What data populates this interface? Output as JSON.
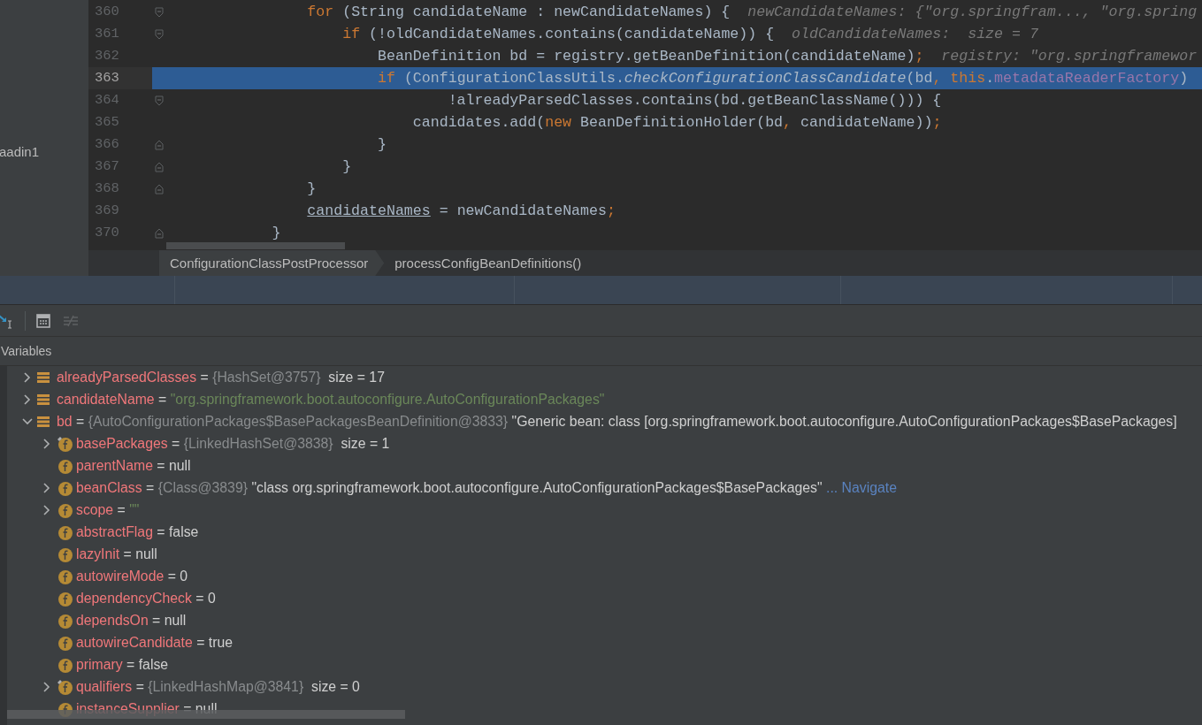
{
  "sidebar": {
    "items": [
      "aadin1"
    ]
  },
  "editor": {
    "lines": [
      {
        "number": "360",
        "current": false,
        "kind": "opening",
        "segments": [
          {
            "kind": "keyword",
            "text": "                for"
          },
          {
            "kind": "plain",
            "text": " (String candidateName : newCandidateNames) {"
          },
          {
            "kind": "hint",
            "text": "  newCandidateNames: {\"org.springfram..., \"org.spring"
          }
        ]
      },
      {
        "number": "361",
        "current": false,
        "kind": "opening",
        "segments": [
          {
            "kind": "keyword",
            "text": "                    if"
          },
          {
            "kind": "plain",
            "text": " (!oldCandidateNames.contains(candidateName)) {"
          },
          {
            "kind": "hint",
            "text": "  oldCandidateNames:  size = 7"
          }
        ]
      },
      {
        "number": "362",
        "current": false,
        "kind": "plain",
        "segments": [
          {
            "kind": "plain",
            "text": "                        BeanDefinition bd = registry.getBeanDefinition(candidateName)"
          },
          {
            "kind": "punct",
            "text": ";"
          },
          {
            "kind": "hint",
            "text": "  registry: \"org.springframewor"
          }
        ]
      },
      {
        "number": "363",
        "current": true,
        "kind": "plain",
        "segments": [
          {
            "kind": "keyword",
            "text": "                        if"
          },
          {
            "kind": "plain",
            "text": " (ConfigurationClassUtils."
          },
          {
            "kind": "call",
            "text": "checkConfigurationClassCandidate"
          },
          {
            "kind": "plain",
            "text": "(bd"
          },
          {
            "kind": "punct",
            "text": ", "
          },
          {
            "kind": "keyword",
            "text": "this"
          },
          {
            "kind": "plain",
            "text": "."
          },
          {
            "kind": "field",
            "text": "metadataReaderFactory"
          },
          {
            "kind": "plain",
            "text": ")"
          }
        ]
      },
      {
        "number": "364",
        "current": false,
        "kind": "opening",
        "segments": [
          {
            "kind": "plain",
            "text": "                                !alreadyParsedClasses.contains(bd.getBeanClassName())) {"
          }
        ]
      },
      {
        "number": "365",
        "current": false,
        "kind": "plain",
        "segments": [
          {
            "kind": "plain",
            "text": "                            candidates.add("
          },
          {
            "kind": "keyword",
            "text": "new"
          },
          {
            "kind": "plain",
            "text": " BeanDefinitionHolder(bd"
          },
          {
            "kind": "punct",
            "text": ", "
          },
          {
            "kind": "plain",
            "text": "candidateName))"
          },
          {
            "kind": "punct",
            "text": ";"
          }
        ]
      },
      {
        "number": "366",
        "current": false,
        "kind": "closing",
        "segments": [
          {
            "kind": "plain",
            "text": "                        }"
          }
        ]
      },
      {
        "number": "367",
        "current": false,
        "kind": "closing",
        "segments": [
          {
            "kind": "plain",
            "text": "                    }"
          }
        ]
      },
      {
        "number": "368",
        "current": false,
        "kind": "closing",
        "segments": [
          {
            "kind": "plain",
            "text": "                }"
          }
        ]
      },
      {
        "number": "369",
        "current": false,
        "kind": "plain",
        "segments": [
          {
            "kind": "link",
            "text": "                candidateNames"
          },
          {
            "kind": "plain",
            "text": " = newCandidateNames"
          },
          {
            "kind": "punct",
            "text": ";"
          }
        ]
      },
      {
        "number": "370",
        "current": false,
        "kind": "closing",
        "segments": [
          {
            "kind": "plain",
            "text": "            }"
          }
        ]
      }
    ]
  },
  "breadcrumbs": [
    {
      "text": "ConfigurationClassPostProcessor",
      "selected": true
    },
    {
      "text": "processConfigBeanDefinitions()",
      "selected": false
    }
  ],
  "variables_panel": {
    "title": "Variables",
    "variables": [
      {
        "kind": "variable",
        "name": "alreadyParsedClasses",
        "expandable": true,
        "expanded": false,
        "marked": false,
        "value": [
          {
            "kind": "plain",
            "text": "="
          },
          {
            "kind": "type",
            "text": "{HashSet@3757}"
          },
          {
            "kind": "plain",
            "text": " size = 17"
          }
        ]
      },
      {
        "kind": "variable",
        "name": "candidateName",
        "expandable": true,
        "expanded": false,
        "marked": false,
        "value": [
          {
            "kind": "plain",
            "text": "="
          },
          {
            "kind": "string",
            "text": "\"org.springframework.boot.autoconfigure.AutoConfigurationPackages\""
          }
        ]
      },
      {
        "kind": "variable",
        "name": "bd",
        "expandable": true,
        "expanded": true,
        "marked": false,
        "value": [
          {
            "kind": "plain",
            "text": "="
          },
          {
            "kind": "type",
            "text": "{AutoConfigurationPackages$BasePackagesBeanDefinition@3833}"
          },
          {
            "kind": "plain",
            "text": "\"Generic bean: class [org.springframework.boot.autoconfigure.AutoConfigurationPackages$BasePackages]"
          }
        ],
        "children": [
          {
            "kind": "field",
            "name": "basePackages",
            "expandable": true,
            "expanded": false,
            "marked": true,
            "value": [
              {
                "kind": "plain",
                "text": "="
              },
              {
                "kind": "type",
                "text": "{LinkedHashSet@3838}"
              },
              {
                "kind": "plain",
                "text": " size = 1"
              }
            ]
          },
          {
            "kind": "field",
            "name": "parentName",
            "expandable": false,
            "expanded": false,
            "marked": false,
            "value": [
              {
                "kind": "plain",
                "text": "= null"
              }
            ]
          },
          {
            "kind": "field",
            "name": "beanClass",
            "expandable": true,
            "expanded": false,
            "marked": false,
            "value": [
              {
                "kind": "plain",
                "text": "="
              },
              {
                "kind": "type",
                "text": "{Class@3839}"
              },
              {
                "kind": "plain",
                "text": "\"class org.springframework.boot.autoconfigure.AutoConfigurationPackages$BasePackages\""
              },
              {
                "kind": "link",
                "text": "... Navigate"
              }
            ]
          },
          {
            "kind": "field",
            "name": "scope",
            "expandable": true,
            "expanded": false,
            "marked": false,
            "value": [
              {
                "kind": "plain",
                "text": "="
              },
              {
                "kind": "string",
                "text": "\"\""
              }
            ]
          },
          {
            "kind": "field",
            "name": "abstractFlag",
            "expandable": false,
            "expanded": false,
            "marked": false,
            "value": [
              {
                "kind": "plain",
                "text": "= false"
              }
            ]
          },
          {
            "kind": "field",
            "name": "lazyInit",
            "expandable": false,
            "expanded": false,
            "marked": false,
            "value": [
              {
                "kind": "plain",
                "text": "= null"
              }
            ]
          },
          {
            "kind": "field",
            "name": "autowireMode",
            "expandable": false,
            "expanded": false,
            "marked": false,
            "value": [
              {
                "kind": "plain",
                "text": "= 0"
              }
            ]
          },
          {
            "kind": "field",
            "name": "dependencyCheck",
            "expandable": false,
            "expanded": false,
            "marked": false,
            "value": [
              {
                "kind": "plain",
                "text": "= 0"
              }
            ]
          },
          {
            "kind": "field",
            "name": "dependsOn",
            "expandable": false,
            "expanded": false,
            "marked": false,
            "value": [
              {
                "kind": "plain",
                "text": "= null"
              }
            ]
          },
          {
            "kind": "field",
            "name": "autowireCandidate",
            "expandable": false,
            "expanded": false,
            "marked": false,
            "value": [
              {
                "kind": "plain",
                "text": "= true"
              }
            ]
          },
          {
            "kind": "field",
            "name": "primary",
            "expandable": false,
            "expanded": false,
            "marked": false,
            "value": [
              {
                "kind": "plain",
                "text": "= false"
              }
            ]
          },
          {
            "kind": "field",
            "name": "qualifiers",
            "expandable": true,
            "expanded": false,
            "marked": true,
            "value": [
              {
                "kind": "plain",
                "text": "="
              },
              {
                "kind": "type",
                "text": "{LinkedHashMap@3841}"
              },
              {
                "kind": "plain",
                "text": " size = 0"
              }
            ]
          },
          {
            "kind": "field",
            "name": "instanceSupplier",
            "expandable": false,
            "expanded": false,
            "marked": false,
            "value": [
              {
                "kind": "plain",
                "text": "= null"
              }
            ]
          }
        ]
      }
    ]
  }
}
